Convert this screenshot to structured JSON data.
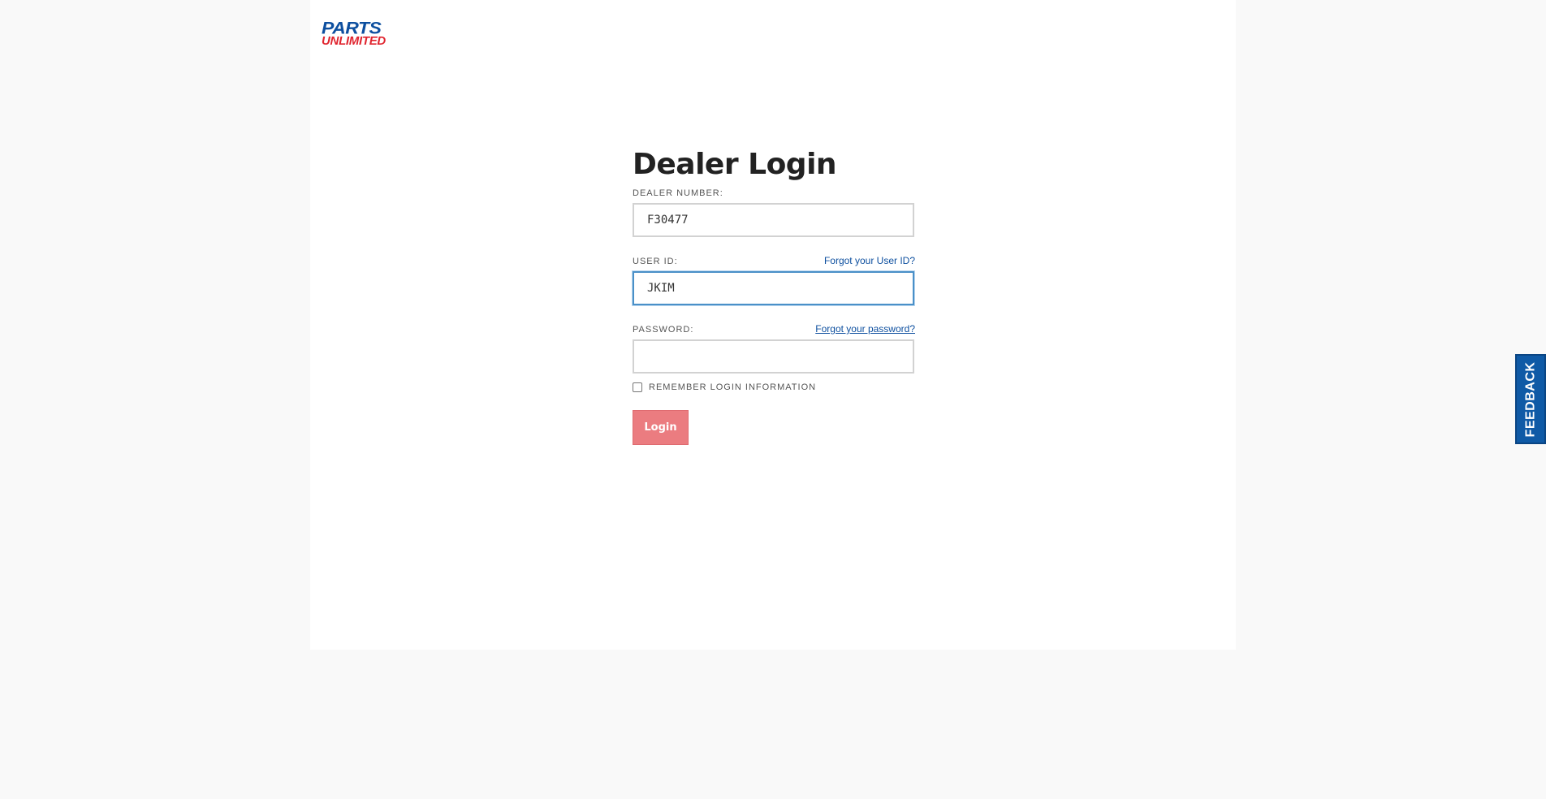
{
  "logo": {
    "line1": "PARTS",
    "line2": "UNLIMITED"
  },
  "login": {
    "title": "Dealer Login",
    "dealer_number": {
      "label": "DEALER NUMBER:",
      "value": "F30477"
    },
    "user_id": {
      "label": "USER ID:",
      "value": "JKIM",
      "forgot_link": "Forgot your User ID?"
    },
    "password": {
      "label": "PASSWORD:",
      "value": "",
      "forgot_link": "Forgot your password?"
    },
    "remember": {
      "label": "REMEMBER LOGIN INFORMATION",
      "checked": false
    },
    "submit_label": "Login"
  },
  "feedback": {
    "label": "FEEDBACK"
  },
  "colors": {
    "brand_blue": "#0d4f9f",
    "brand_red": "#e0242e",
    "login_button": "#eb7c80",
    "feedback_tab": "#0f5aa6"
  }
}
